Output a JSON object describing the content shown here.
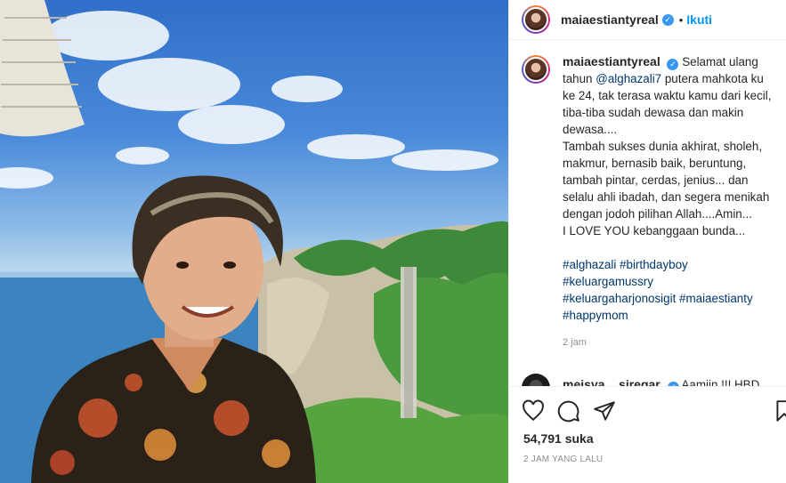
{
  "post": {
    "username": "maiaestiantyreal",
    "verified_symbol": "✓",
    "dot": "•",
    "follow_label": "Ikuti"
  },
  "caption": {
    "username": "maiaestiantyreal",
    "part1": "Selamat ulang tahun ",
    "mention": "@alghazali7",
    "part2": " putera mahkota ku ke 24, tak terasa waktu kamu dari kecil, tiba-tiba sudah dewasa dan makin dewasa....",
    "line2": "Tambah sukses dunia akhirat, sholeh, makmur, bernasib baik, beruntung, tambah pintar, cerdas, jenius... dan selalu ahli ibadah, dan segera menikah dengan jodoh pilihan Allah....Amin...",
    "line3": "I LOVE YOU kebanggaan bunda...",
    "hashtags": [
      "#alghazali",
      "#birthdayboy",
      "#keluargamussry",
      "#keluargaharjonosigit",
      "#maiaestianty",
      "#happymom"
    ],
    "time": "2 jam"
  },
  "comment2": {
    "username": "meisya__siregar",
    "text": "Aamiin !!! HBD"
  },
  "actions": {
    "likes": "54,791 suka",
    "ago": "2 JAM YANG LALU"
  },
  "colors": {
    "link": "#00376b",
    "follow": "#0095f6",
    "verified": "#3897f0"
  },
  "icons": [
    "heart-icon",
    "comment-icon",
    "share-icon",
    "bookmark-icon"
  ]
}
